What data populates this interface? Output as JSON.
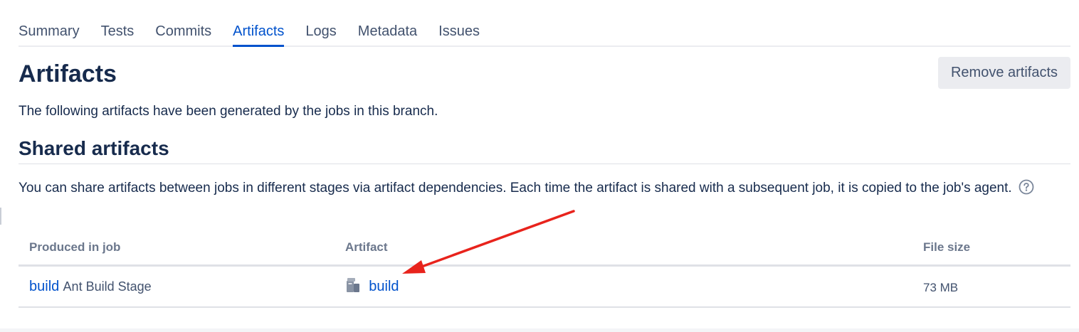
{
  "tabs": [
    {
      "label": "Summary",
      "active": false
    },
    {
      "label": "Tests",
      "active": false
    },
    {
      "label": "Commits",
      "active": false
    },
    {
      "label": "Artifacts",
      "active": true
    },
    {
      "label": "Logs",
      "active": false
    },
    {
      "label": "Metadata",
      "active": false
    },
    {
      "label": "Issues",
      "active": false
    }
  ],
  "header": {
    "title": "Artifacts",
    "remove_button_label": "Remove artifacts"
  },
  "intro": "The following artifacts have been generated by the jobs in this branch.",
  "shared": {
    "title": "Shared artifacts",
    "description": "You can share artifacts between jobs in different stages via artifact dependencies. Each time the artifact is shared with a subsequent job, it is copied to the job's agent."
  },
  "table": {
    "columns": [
      "Produced in job",
      "Artifact",
      "File size"
    ],
    "rows": [
      {
        "job_link": "build",
        "stage": "Ant Build Stage",
        "artifact": "build",
        "size": "73 MB"
      }
    ]
  },
  "colors": {
    "accent": "#0052cc",
    "annotation_arrow": "#e8231c"
  },
  "icons": {
    "help": "question-circle-icon",
    "artifact": "artifact-box-icon"
  }
}
